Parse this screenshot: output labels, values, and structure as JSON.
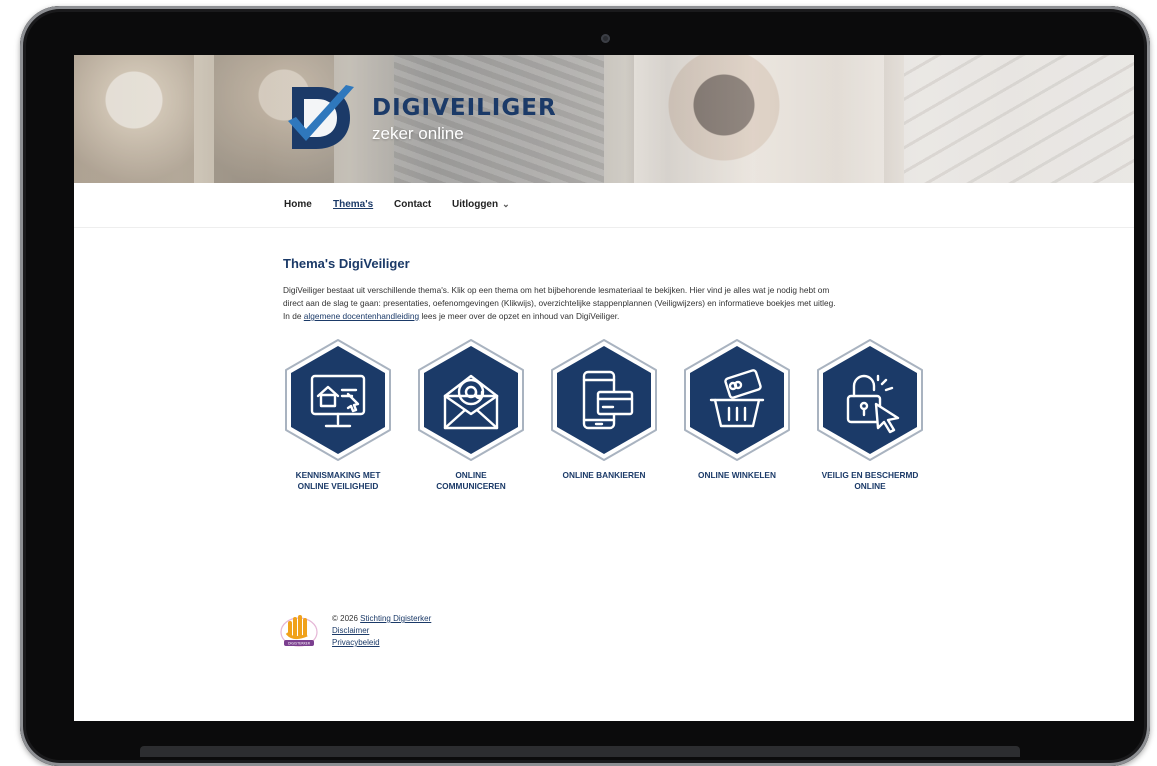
{
  "header": {
    "brand_title": "DIGIVEILIGER",
    "brand_subtitle": "zeker online"
  },
  "nav": {
    "items": [
      {
        "label": "Home",
        "active": false
      },
      {
        "label": "Thema's",
        "active": true
      },
      {
        "label": "Contact",
        "active": false
      },
      {
        "label": "Uitloggen",
        "active": false,
        "has_dropdown": true
      }
    ]
  },
  "main": {
    "title": "Thema's DigiVeiliger",
    "intro_line1": "DigiVeiliger bestaat uit verschillende thema's. Klik op een thema om het bijbehorende lesmateriaal te bekijken. Hier vind je alles wat je nodig hebt om",
    "intro_line2": "direct aan de slag te gaan: presentaties, oefenomgevingen (Klikwijs), overzichtelijke stappenplannen (Veiligwijzers) en informatieve boekjes met uitleg.",
    "intro_line3_pre": "In de",
    "intro_link": "algemene docentenhandleiding",
    "intro_line3_post": "lees je meer over de opzet en inhoud van DigiVeiliger.",
    "themes": [
      {
        "label_1": "KENNISMAKING MET",
        "label_2": "ONLINE VEILIGHEID",
        "icon": "computer-house-icon"
      },
      {
        "label_1": "ONLINE",
        "label_2": "COMMUNICEREN",
        "icon": "email-envelope-icon"
      },
      {
        "label_1": "ONLINE BANKIEREN",
        "label_2": "",
        "icon": "phone-card-icon"
      },
      {
        "label_1": "ONLINE WINKELEN",
        "label_2": "",
        "icon": "shopping-basket-icon"
      },
      {
        "label_1": "VEILIG EN BESCHERMD",
        "label_2": "ONLINE",
        "icon": "lock-cursor-icon"
      }
    ]
  },
  "footer": {
    "copyright": "© 2026",
    "org_link": "Stichting Digisterker",
    "disclaimer": "Disclaimer",
    "privacy": "Privacybeleid",
    "logo_text": "DIGISTERKER"
  },
  "colors": {
    "brand_navy": "#1b3a68",
    "accent_blue": "#2f78bd",
    "hex_border": "#a9b3c0"
  }
}
